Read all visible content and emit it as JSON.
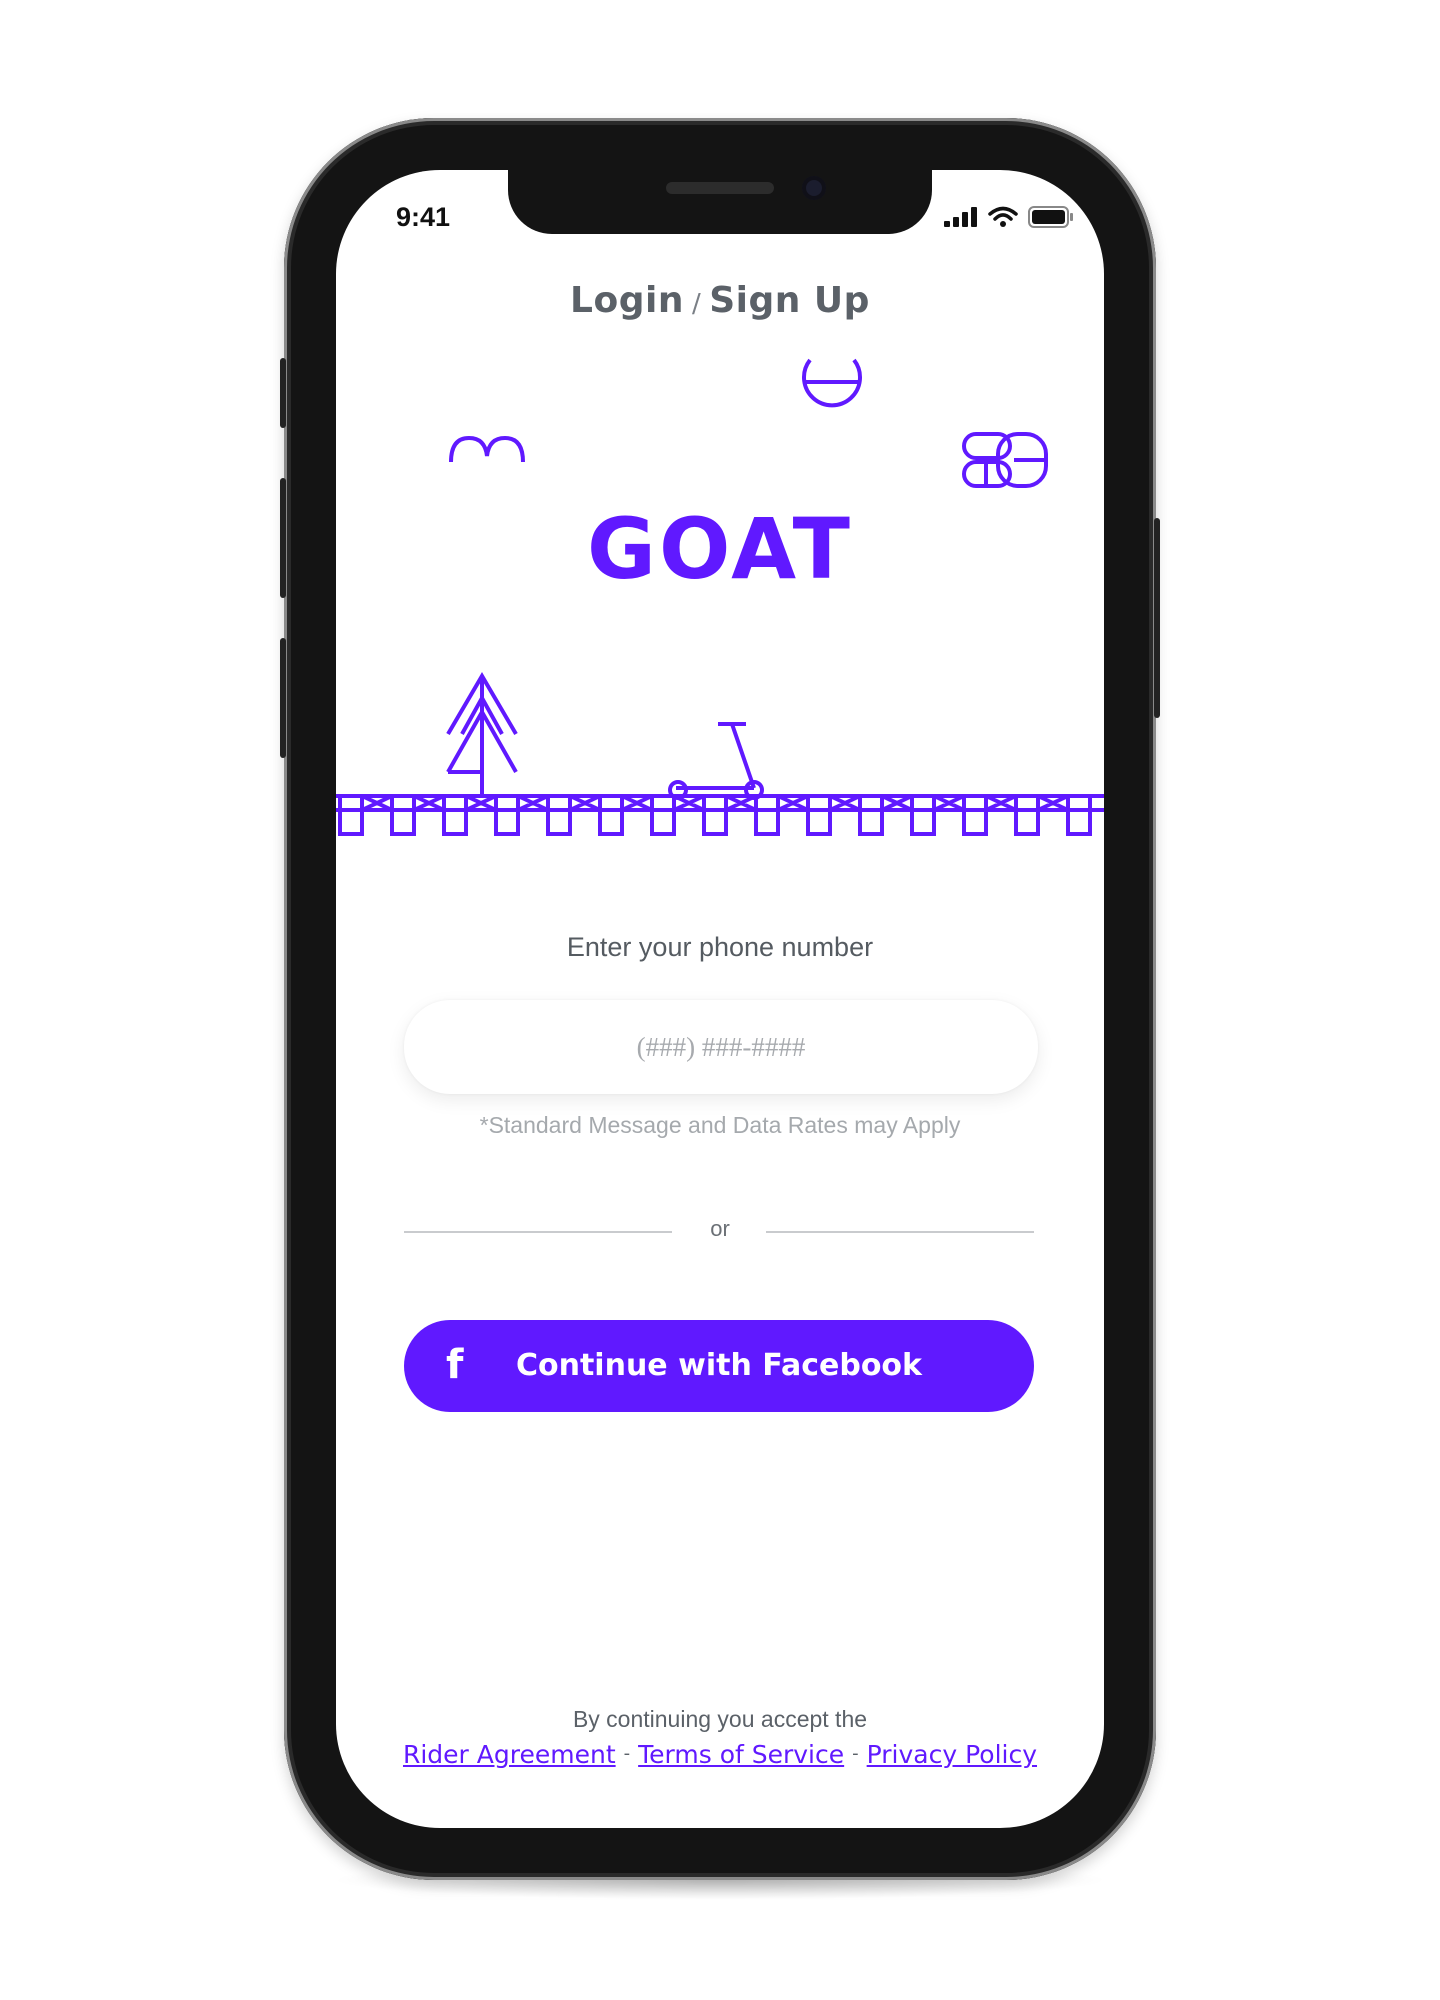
{
  "status_bar": {
    "time": "9:41"
  },
  "header": {
    "login": "Login",
    "separator": "/",
    "signup": "Sign Up"
  },
  "brand": {
    "logo_text": "GOAT",
    "accent_color": "#6019ff"
  },
  "illustration": {
    "icons": [
      "arch-icon",
      "half-circle-icon",
      "chain-link-icon",
      "pine-tree-icon",
      "scooter-icon",
      "rail-track-icon"
    ]
  },
  "phone_entry": {
    "label": "Enter your phone number",
    "placeholder": "(###) ###-####",
    "value": "",
    "note": "*Standard Message and Data Rates may Apply"
  },
  "divider": {
    "text": "or"
  },
  "facebook_button": {
    "icon": "f",
    "label": "Continue with Facebook"
  },
  "legal": {
    "intro": "By continuing you accept the",
    "rider_agreement": "Rider Agreement",
    "terms": "Terms of Service",
    "privacy": "Privacy Policy",
    "separator": "-"
  }
}
